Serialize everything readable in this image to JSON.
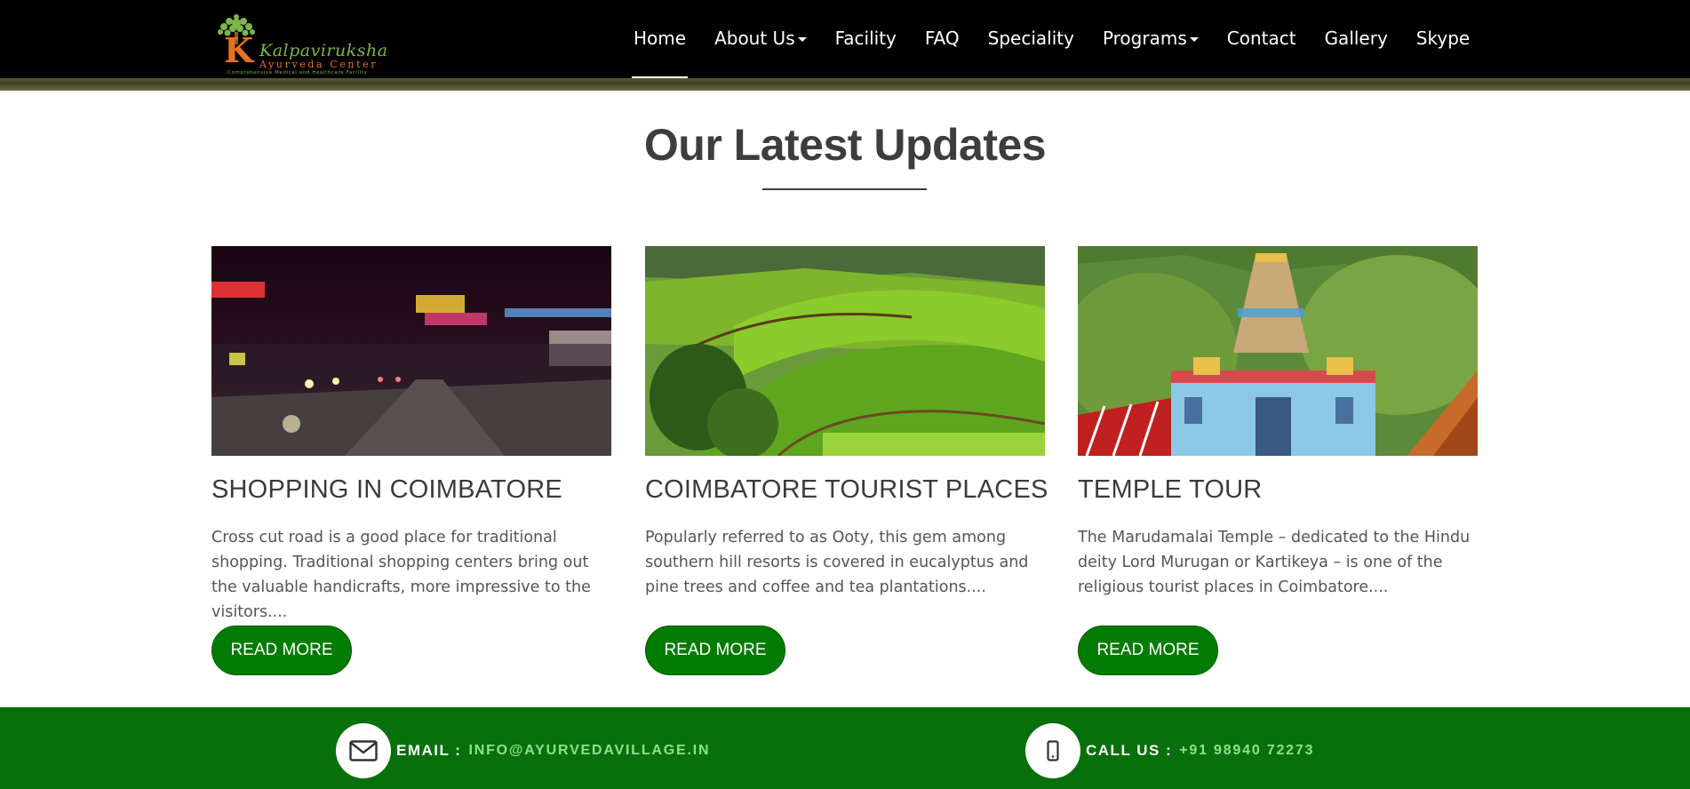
{
  "header": {
    "logo": {
      "letter": "K",
      "name": "Kalpaviruksha",
      "subtitle": "Ayurveda Center",
      "tagline": "Comprehensive Medical and Healthcare Facility"
    },
    "nav": [
      {
        "label": "Home",
        "active": true,
        "dropdown": false
      },
      {
        "label": "About Us",
        "active": false,
        "dropdown": true
      },
      {
        "label": "Facility",
        "active": false,
        "dropdown": false
      },
      {
        "label": "FAQ",
        "active": false,
        "dropdown": false
      },
      {
        "label": "Speciality",
        "active": false,
        "dropdown": false
      },
      {
        "label": "Programs",
        "active": false,
        "dropdown": true
      },
      {
        "label": "Contact",
        "active": false,
        "dropdown": false
      },
      {
        "label": "Gallery",
        "active": false,
        "dropdown": false
      },
      {
        "label": "Skype",
        "active": false,
        "dropdown": false
      }
    ]
  },
  "updates": {
    "title": "Our Latest Updates",
    "cards": [
      {
        "image": "night-street-shopping-photo",
        "title": "SHOPPING IN COIMBATORE",
        "text": "Cross cut road is a good place for traditional shopping. Traditional shopping centers bring out the valuable handicrafts, more impressive to the visitors....",
        "button": "READ MORE"
      },
      {
        "image": "tea-plantation-hills-photo",
        "title": "COIMBATORE TOURIST PLACES",
        "text": "Popularly referred to as Ooty, this gem among southern hill resorts is covered in eucalyptus and pine trees and coffee and tea plantations....",
        "button": "READ MORE"
      },
      {
        "image": "marudamalai-temple-photo",
        "title": "TEMPLE TOUR",
        "text": "The Marudamalai Temple – dedicated to the Hindu deity Lord Murugan or Kartikeya – is one of the religious tourist places in Coimbatore....",
        "button": "READ MORE"
      }
    ]
  },
  "footer": {
    "email_label": "EMAIL :",
    "email_value": "INFO@AYURVEDAVILLAGE.IN",
    "email_icon": "envelope-icon",
    "call_label": "CALL US :",
    "call_value": "+91 98940 72273",
    "call_icon": "mobile-phone-icon"
  },
  "colors": {
    "header_bg": "#000000",
    "button_green": "#027c02",
    "footer_green": "#08700a",
    "title_text": "#3d3d3d"
  }
}
